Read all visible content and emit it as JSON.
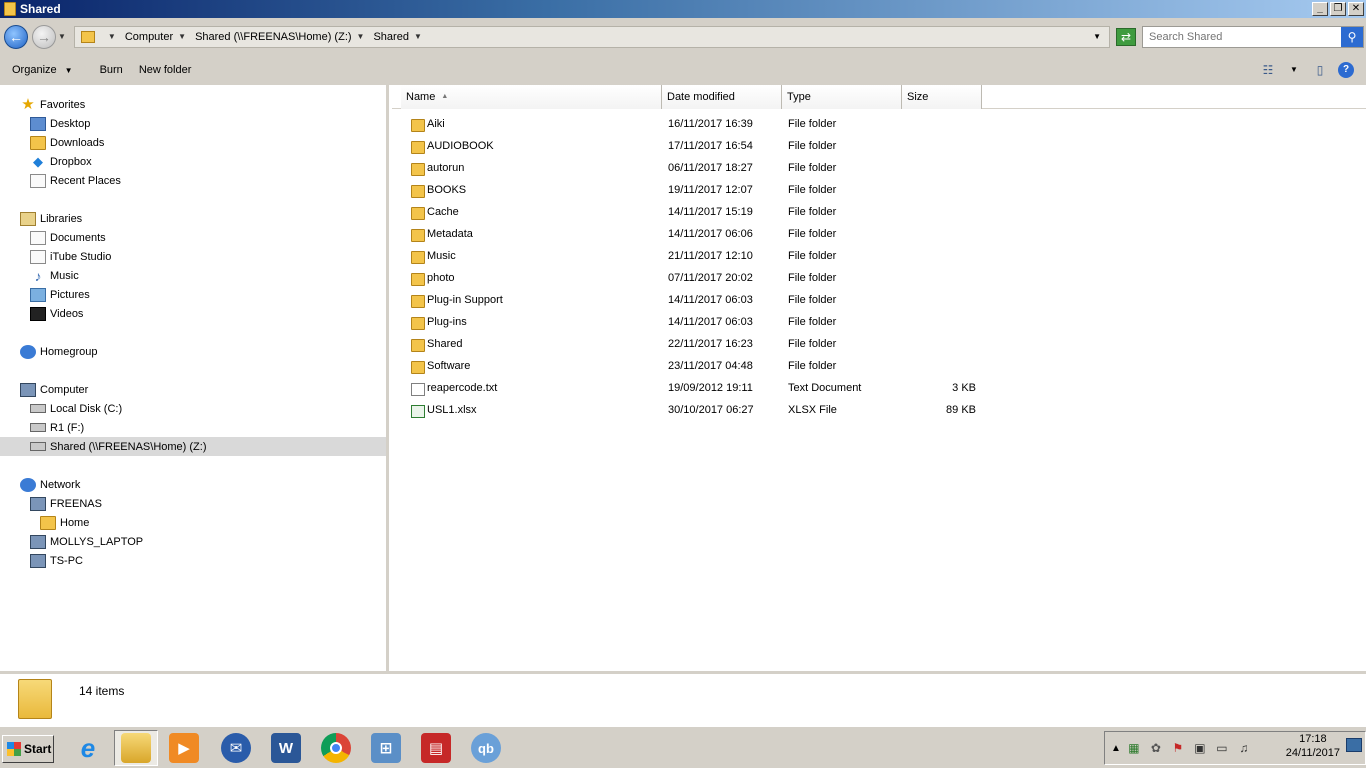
{
  "window": {
    "title": "Shared"
  },
  "address": {
    "crumbs": [
      "Computer",
      "Shared (\\\\FREENAS\\Home) (Z:)",
      "Shared"
    ],
    "search_placeholder": "Search Shared"
  },
  "toolbar": {
    "organize": "Organize",
    "burn": "Burn",
    "new_folder": "New folder"
  },
  "nav": {
    "favorites": {
      "label": "Favorites",
      "items": [
        "Desktop",
        "Downloads",
        "Dropbox",
        "Recent Places"
      ]
    },
    "libraries": {
      "label": "Libraries",
      "items": [
        "Documents",
        "iTube Studio",
        "Music",
        "Pictures",
        "Videos"
      ]
    },
    "homegroup": "Homegroup",
    "computer": {
      "label": "Computer",
      "items": [
        "Local Disk (C:)",
        "R1 (F:)",
        "Shared (\\\\FREENAS\\Home) (Z:)"
      ]
    },
    "network": {
      "label": "Network",
      "items": [
        "FREENAS",
        "Home",
        "MOLLYS_LAPTOP",
        "TS-PC"
      ]
    }
  },
  "columns": {
    "name": "Name",
    "date": "Date modified",
    "type": "Type",
    "size": "Size"
  },
  "files": [
    {
      "name": "Aiki",
      "date": "16/11/2017 16:39",
      "type": "File folder",
      "size": "",
      "icon": "folder"
    },
    {
      "name": "AUDIOBOOK",
      "date": "17/11/2017 16:54",
      "type": "File folder",
      "size": "",
      "icon": "folder"
    },
    {
      "name": "autorun",
      "date": "06/11/2017 18:27",
      "type": "File folder",
      "size": "",
      "icon": "folder"
    },
    {
      "name": "BOOKS",
      "date": "19/11/2017 12:07",
      "type": "File folder",
      "size": "",
      "icon": "folder"
    },
    {
      "name": "Cache",
      "date": "14/11/2017 15:19",
      "type": "File folder",
      "size": "",
      "icon": "folder"
    },
    {
      "name": "Metadata",
      "date": "14/11/2017 06:06",
      "type": "File folder",
      "size": "",
      "icon": "folder"
    },
    {
      "name": "Music",
      "date": "21/11/2017 12:10",
      "type": "File folder",
      "size": "",
      "icon": "folder"
    },
    {
      "name": "photo",
      "date": "07/11/2017 20:02",
      "type": "File folder",
      "size": "",
      "icon": "folder"
    },
    {
      "name": "Plug-in Support",
      "date": "14/11/2017 06:03",
      "type": "File folder",
      "size": "",
      "icon": "folder"
    },
    {
      "name": "Plug-ins",
      "date": "14/11/2017 06:03",
      "type": "File folder",
      "size": "",
      "icon": "folder"
    },
    {
      "name": "Shared",
      "date": "22/11/2017 16:23",
      "type": "File folder",
      "size": "",
      "icon": "folder"
    },
    {
      "name": "Software",
      "date": "23/11/2017 04:48",
      "type": "File folder",
      "size": "",
      "icon": "folder"
    },
    {
      "name": "reapercode.txt",
      "date": "19/09/2012 19:11",
      "type": "Text Document",
      "size": "3 KB",
      "icon": "txt"
    },
    {
      "name": "USL1.xlsx",
      "date": "30/10/2017 06:27",
      "type": "XLSX File",
      "size": "89 KB",
      "icon": "xlsx"
    }
  ],
  "status": {
    "count": "14 items"
  },
  "taskbar": {
    "start": "Start",
    "time": "17:18",
    "date": "24/11/2017"
  }
}
